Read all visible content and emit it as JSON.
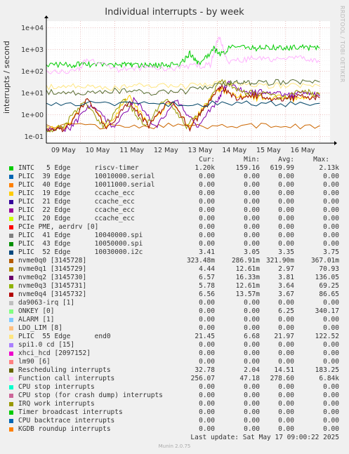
{
  "title": "Individual interrupts - by week",
  "side_label": "RRDTOOL / TOBI OETIKER",
  "ylabel": "interrupts / second",
  "columns": [
    "Cur:",
    "Min:",
    "Avg:",
    "Max:"
  ],
  "last_update": "Last update: Sat May 17 09:00:22 2025",
  "footer": "Munin 2.0.75",
  "chart_data": {
    "type": "line",
    "title": "Individual interrupts - by week",
    "ylabel": "interrupts / second",
    "yscale": "log",
    "ylim": [
      0.05,
      20000
    ],
    "yticks": [
      "1e-01",
      "1e+00",
      "1e+01",
      "1e+02",
      "1e+03",
      "1e+04"
    ],
    "x_ticks": [
      "09 May",
      "10 May",
      "11 May",
      "12 May",
      "13 May",
      "14 May",
      "15 May",
      "16 May"
    ],
    "grid": true,
    "legend_placement": "bottom",
    "series": [
      {
        "name": "INTC   5 Edge      riscv-timer",
        "color": "#00cc00",
        "cur": "1.20k",
        "min": "159.16",
        "avg": "619.99",
        "max": "2.13k",
        "x": [
          0,
          0.8,
          1.1,
          1.6,
          2.2,
          2.5,
          3.0,
          3.4,
          3.9,
          4.2,
          4.5,
          4.9,
          5.1,
          5.4,
          6.0,
          6.5,
          7.0,
          7.5,
          8.0
        ],
        "y": [
          200,
          200,
          220,
          190,
          210,
          200,
          190,
          205,
          200,
          700,
          200,
          1100,
          600,
          1300,
          1200,
          1250,
          1200,
          1300,
          1200
        ]
      },
      {
        "name": "nvme0q0 [3145728]",
        "color": "#cc6600",
        "cur": "323.48m",
        "min": "286.91m",
        "avg": "321.90m",
        "max": "367.01m",
        "x": [
          0,
          2,
          4,
          6,
          8
        ],
        "y": [
          0.32,
          0.31,
          0.33,
          0.32,
          0.32
        ]
      },
      {
        "name": "nvme0q1 [3145729]",
        "color": "#ffcc00",
        "cur": "4.44",
        "min": "12.61m",
        "avg": "2.97",
        "max": "70.93",
        "x": [
          0,
          0.6,
          1.2,
          1.8,
          2.4,
          3.0,
          3.6,
          4.2,
          4.8,
          5.1,
          5.6,
          6.2,
          6.8,
          7.4,
          8.0
        ],
        "y": [
          0.25,
          0.3,
          5,
          0.3,
          8,
          0.3,
          4,
          0.3,
          6,
          15,
          8,
          6,
          7,
          5,
          9
        ]
      },
      {
        "name": "nvme0q2 [3145730]",
        "color": "#8000aa",
        "cur": "6.57",
        "min": "16.33m",
        "avg": "3.81",
        "max": "136.05",
        "x": [
          0,
          0.7,
          1.3,
          2.0,
          2.6,
          3.2,
          3.8,
          4.4,
          5.0,
          5.3,
          5.9,
          6.5,
          7.1,
          7.7,
          8.0
        ],
        "y": [
          0.2,
          0.25,
          3,
          0.25,
          6,
          0.25,
          5,
          0.3,
          4,
          30,
          10,
          12,
          8,
          11,
          7
        ]
      },
      {
        "name": "nvme0q3 [3145731]",
        "color": "#999900",
        "cur": "5.78",
        "min": "12.61m",
        "avg": "3.64",
        "max": "69.25",
        "x": [
          0,
          0.5,
          1.1,
          1.7,
          2.3,
          2.9,
          3.5,
          4.1,
          4.7,
          5.1,
          5.7,
          6.3,
          6.9,
          7.5,
          8.0
        ],
        "y": [
          0.2,
          0.3,
          4,
          0.3,
          5,
          0.3,
          6,
          0.3,
          3,
          40,
          12,
          10,
          6,
          14,
          8
        ]
      },
      {
        "name": "nvme0q4 [3145732]",
        "color": "#990000",
        "cur": "6.56",
        "min": "13.57m",
        "avg": "3.67",
        "max": "86.65",
        "x": [
          0,
          0.6,
          1.2,
          1.8,
          2.4,
          3.0,
          3.6,
          4.2,
          4.8,
          5.1,
          5.6,
          6.2,
          6.8,
          7.4,
          8.0
        ],
        "y": [
          0.2,
          0.25,
          5,
          0.25,
          4,
          0.3,
          5,
          0.25,
          5,
          20,
          6,
          8,
          5,
          7,
          6
        ]
      },
      {
        "name": "PLIC  52 Edge      10030000.i2c",
        "color": "#004466",
        "cur": "3.41",
        "min": "3.05",
        "avg": "3.35",
        "max": "3.75",
        "x": [
          0,
          2,
          4,
          6,
          8
        ],
        "y": [
          3.3,
          3.4,
          3.35,
          3.3,
          3.4
        ]
      },
      {
        "name": "PLIC  55 Edge      end0",
        "color": "#ffe680",
        "cur": "21.45",
        "min": "6.68",
        "avg": "21.97",
        "max": "122.52",
        "x": [
          0,
          1,
          2,
          3,
          4,
          5,
          6,
          7,
          8
        ],
        "y": [
          20,
          22,
          18,
          25,
          20,
          30,
          21,
          24,
          21
        ]
      },
      {
        "name": "Rescheduling interrupts",
        "color": "#556b2f",
        "cur": "32.78",
        "min": "2.04",
        "avg": "14.51",
        "max": "183.25",
        "x": [
          0,
          1,
          2,
          3,
          4,
          5,
          5.5,
          6,
          7,
          8
        ],
        "y": [
          12,
          10,
          14,
          11,
          12,
          25,
          30,
          28,
          35,
          32
        ]
      },
      {
        "name": "Function call interrupts",
        "color": "#ffb3ff",
        "cur": "256.07",
        "min": "47.18",
        "avg": "278.60",
        "max": "6.84k",
        "x": [
          0,
          0.9,
          1.2,
          2.0,
          2.8,
          3.5,
          4.2,
          4.8,
          5.05,
          5.3,
          6.0,
          6.7,
          7.4,
          8.0
        ],
        "y": [
          100,
          110,
          400,
          120,
          150,
          130,
          180,
          200,
          5000,
          300,
          400,
          350,
          420,
          256
        ]
      }
    ]
  },
  "legend": [
    {
      "color": "#00cc00",
      "name": "INTC   5 Edge      riscv-timer",
      "cur": "1.20k",
      "min": "159.16",
      "avg": "619.99",
      "max": "2.13k"
    },
    {
      "color": "#0066b3",
      "name": "PLIC  39 Edge      10010000.serial",
      "cur": "0.00",
      "min": "0.00",
      "avg": "0.00",
      "max": "0.00"
    },
    {
      "color": "#ff8000",
      "name": "PLIC  40 Edge      10011000.serial",
      "cur": "0.00",
      "min": "0.00",
      "avg": "0.00",
      "max": "0.00"
    },
    {
      "color": "#ffcc00",
      "name": "PLIC  19 Edge      ccache_ecc",
      "cur": "0.00",
      "min": "0.00",
      "avg": "0.00",
      "max": "0.00"
    },
    {
      "color": "#330099",
      "name": "PLIC  21 Edge      ccache_ecc",
      "cur": "0.00",
      "min": "0.00",
      "avg": "0.00",
      "max": "0.00"
    },
    {
      "color": "#990099",
      "name": "PLIC  22 Edge      ccache_ecc",
      "cur": "0.00",
      "min": "0.00",
      "avg": "0.00",
      "max": "0.00"
    },
    {
      "color": "#ccff00",
      "name": "PLIC  20 Edge      ccache_ecc",
      "cur": "0.00",
      "min": "0.00",
      "avg": "0.00",
      "max": "0.00"
    },
    {
      "color": "#ff0000",
      "name": "PCIe PME, aerdrv [0]",
      "cur": "0.00",
      "min": "0.00",
      "avg": "0.00",
      "max": "0.00"
    },
    {
      "color": "#808080",
      "name": "PLIC  41 Edge      10040000.spi",
      "cur": "0.00",
      "min": "0.00",
      "avg": "0.00",
      "max": "0.00"
    },
    {
      "color": "#008f00",
      "name": "PLIC  43 Edge      10050000.spi",
      "cur": "0.00",
      "min": "0.00",
      "avg": "0.00",
      "max": "0.00"
    },
    {
      "color": "#00487d",
      "name": "PLIC  52 Edge      10030000.i2c",
      "cur": "3.41",
      "min": "3.05",
      "avg": "3.35",
      "max": "3.75"
    },
    {
      "color": "#b35a00",
      "name": "nvme0q0 [3145728]",
      "cur": "323.48m",
      "min": "286.91m",
      "avg": "321.90m",
      "max": "367.01m"
    },
    {
      "color": "#b38f00",
      "name": "nvme0q1 [3145729]",
      "cur": "4.44",
      "min": "12.61m",
      "avg": "2.97",
      "max": "70.93"
    },
    {
      "color": "#6b006b",
      "name": "nvme0q2 [3145730]",
      "cur": "6.57",
      "min": "16.33m",
      "avg": "3.81",
      "max": "136.05"
    },
    {
      "color": "#8fb300",
      "name": "nvme0q3 [3145731]",
      "cur": "5.78",
      "min": "12.61m",
      "avg": "3.64",
      "max": "69.25"
    },
    {
      "color": "#b30000",
      "name": "nvme0q4 [3145732]",
      "cur": "6.56",
      "min": "13.57m",
      "avg": "3.67",
      "max": "86.65"
    },
    {
      "color": "#bebebe",
      "name": "da9063-irq [1]",
      "cur": "0.00",
      "min": "0.00",
      "avg": "0.00",
      "max": "0.00"
    },
    {
      "color": "#80ff80",
      "name": "ONKEY [0]",
      "cur": "0.00",
      "min": "0.00",
      "avg": "6.25",
      "max": "340.17"
    },
    {
      "color": "#80c9ff",
      "name": "ALARM [1]",
      "cur": "0.00",
      "min": "0.00",
      "avg": "0.00",
      "max": "0.00"
    },
    {
      "color": "#ffc080",
      "name": "LDO_LIM [8]",
      "cur": "0.00",
      "min": "0.00",
      "avg": "0.00",
      "max": "0.00"
    },
    {
      "color": "#ffe680",
      "name": "PLIC  55 Edge      end0",
      "cur": "21.45",
      "min": "6.68",
      "avg": "21.97",
      "max": "122.52"
    },
    {
      "color": "#aa80ff",
      "name": "spi1.0 cd [15]",
      "cur": "0.00",
      "min": "0.00",
      "avg": "0.00",
      "max": "0.00"
    },
    {
      "color": "#ee00cc",
      "name": "xhci_hcd [2097152]",
      "cur": "0.00",
      "min": "0.00",
      "avg": "0.00",
      "max": "0.00"
    },
    {
      "color": "#ff8080",
      "name": "lm90 [6]",
      "cur": "0.00",
      "min": "0.00",
      "avg": "0.00",
      "max": "0.00"
    },
    {
      "color": "#666600",
      "name": "Rescheduling interrupts",
      "cur": "32.78",
      "min": "2.04",
      "avg": "14.51",
      "max": "183.25"
    },
    {
      "color": "#ffbfff",
      "name": "Function call interrupts",
      "cur": "256.07",
      "min": "47.18",
      "avg": "278.60",
      "max": "6.84k"
    },
    {
      "color": "#00ffcc",
      "name": "CPU stop interrupts",
      "cur": "0.00",
      "min": "0.00",
      "avg": "0.00",
      "max": "0.00"
    },
    {
      "color": "#cc6699",
      "name": "CPU stop (for crash dump) interrupts",
      "cur": "0.00",
      "min": "0.00",
      "avg": "0.00",
      "max": "0.00"
    },
    {
      "color": "#999900",
      "name": "IRQ work interrupts",
      "cur": "0.00",
      "min": "0.00",
      "avg": "0.00",
      "max": "0.00"
    },
    {
      "color": "#00cc00",
      "name": "Timer broadcast interrupts",
      "cur": "0.00",
      "min": "0.00",
      "avg": "0.00",
      "max": "0.00"
    },
    {
      "color": "#0066b3",
      "name": "CPU backtrace interrupts",
      "cur": "0.00",
      "min": "0.00",
      "avg": "0.00",
      "max": "0.00"
    },
    {
      "color": "#ff8000",
      "name": "KGDB roundup interrupts",
      "cur": "0.00",
      "min": "0.00",
      "avg": "0.00",
      "max": "0.00"
    }
  ]
}
